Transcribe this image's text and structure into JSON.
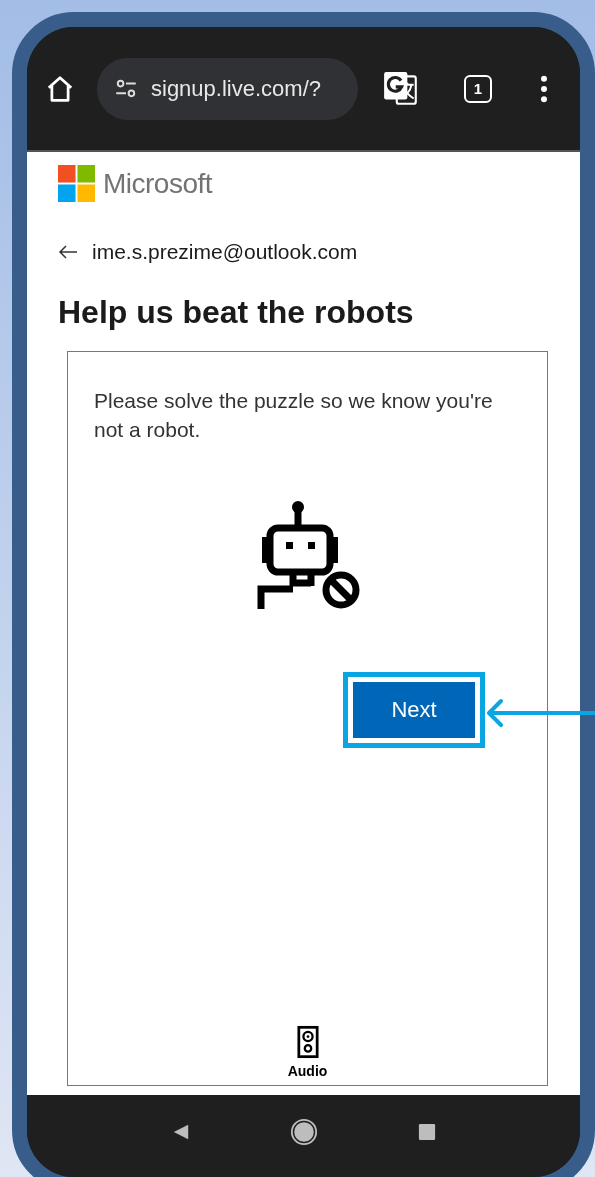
{
  "browser": {
    "url": "signup.live.com/?",
    "tab_count": "1"
  },
  "page": {
    "brand": "Microsoft",
    "back_email": "ime.s.prezime@outlook.com",
    "heading": "Help us beat the robots",
    "puzzle": {
      "instructions": "Please solve the puzzle so we know you're not a robot.",
      "next_button": "Next",
      "audio_label": "Audio"
    }
  }
}
